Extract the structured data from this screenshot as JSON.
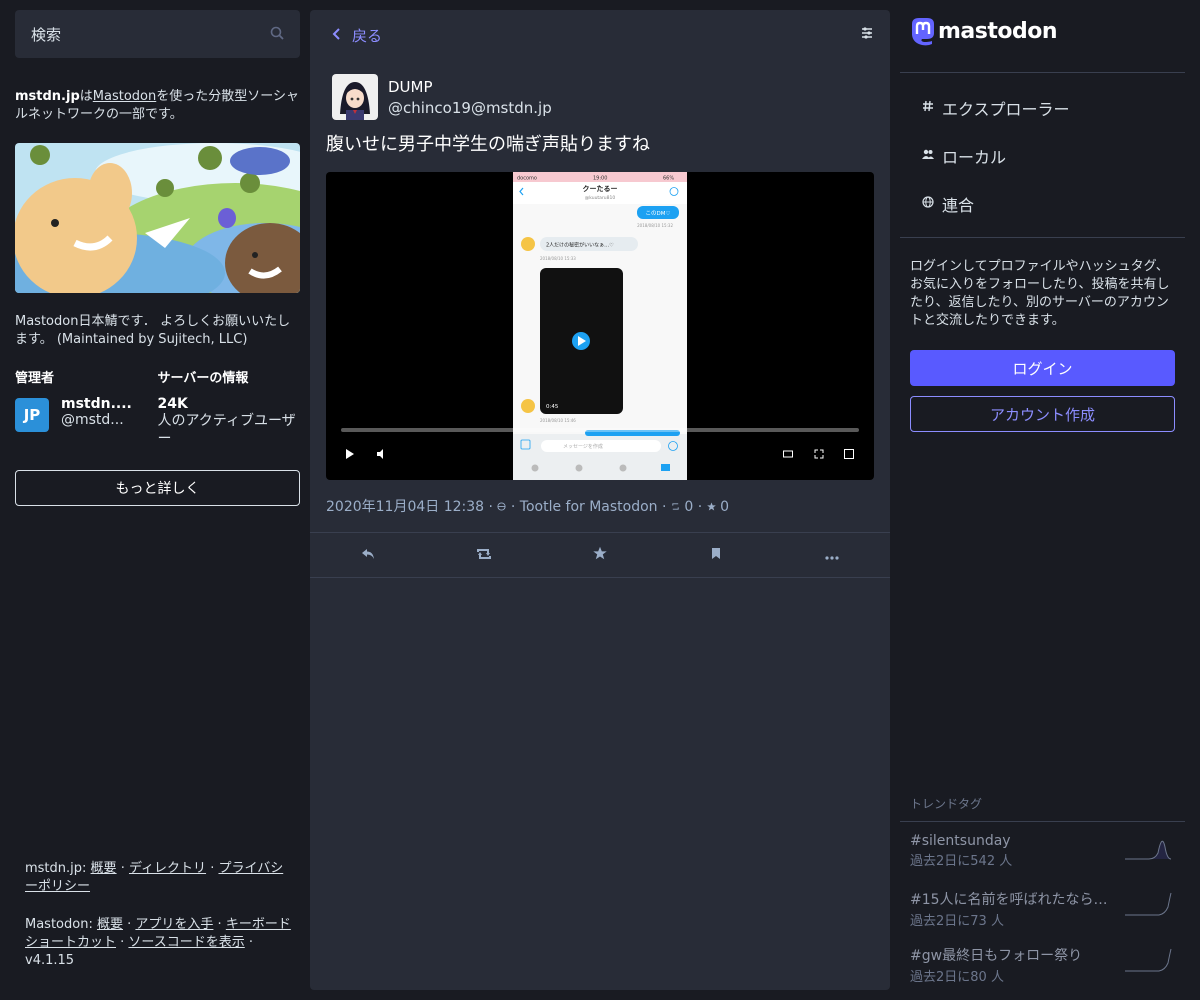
{
  "search": {
    "placeholder": "検索",
    "icon": "search-icon"
  },
  "server": {
    "name": "mstdn.jp",
    "desc_mid": "は",
    "mastodon_link": "Mastodon",
    "desc_tail": "を使った分散型ソーシャルネットワークの一部です。",
    "subtitle": "Mastodon日本鯖です． よろしくお願いいたします。 (Maintained by Sujitech, LLC)",
    "admin_heading": "管理者",
    "info_heading": "サーバーの情報",
    "admin_avatar_text": "JP",
    "admin_name": "mstdn....",
    "admin_handle": "@mstd...",
    "active_users": "24K",
    "active_users_label": "人のアクティブユーザー",
    "more_button": "もっと詳しく"
  },
  "footer": {
    "line1_prefix": "mstdn.jp:",
    "line1_links": [
      "概要",
      "ディレクトリ",
      "プライバシーポリシー"
    ],
    "line2_prefix": "Mastodon:",
    "line2_links": [
      "概要",
      "アプリを入手",
      "キーボードショートカット",
      "ソースコードを表示"
    ],
    "version": "v4.1.15"
  },
  "column": {
    "back_label": "戻る",
    "back_icon": "chevron-left-icon",
    "settings_icon": "sliders-icon"
  },
  "status": {
    "display_name": "DUMP",
    "acct": "@chinco19@mstdn.jp",
    "content": "腹いせに男子中学生の喘ぎ声貼りますね",
    "timestamp": "2020年11月04日 12:38",
    "visibility_icon": "globe-icon",
    "application": "Tootle for Mastodon",
    "reblogs": "0",
    "favourites": "0",
    "video": {
      "phone_title": "クーたるー",
      "phone_sub": "@kuutaru810",
      "bubble_right": "このDM♡",
      "bubble_left": "2人だけの秘密がいいなぁ…♡",
      "date1": "2018/08/10 15:32",
      "date2": "2018/08/10 15:33",
      "date3": "2018/08/10 15:46",
      "clip_time": "0:45",
      "input_placeholder": "メッセージを作成",
      "status_carrier": "docomo",
      "status_time": "19:00",
      "status_battery": "66%"
    }
  },
  "nav": {
    "logo_text": "mastodon",
    "items": [
      {
        "label": "エクスプローラー",
        "icon": "hashtag-icon"
      },
      {
        "label": "ローカル",
        "icon": "users-icon"
      },
      {
        "label": "連合",
        "icon": "globe-icon"
      }
    ],
    "login_text": "ログインしてプロファイルやハッシュタグ、お気に入りをフォローしたり、投稿を共有したり、返信したり、別のサーバーのアカウントと交流したりできます。",
    "login_button": "ログイン",
    "signup_button": "アカウント作成"
  },
  "trends": {
    "title": "トレンドタグ",
    "items": [
      {
        "name": "#silentsunday",
        "count": "過去2日に542 人"
      },
      {
        "name": "#15人に名前を呼ばれたなら…",
        "count": "過去2日に73 人"
      },
      {
        "name": "#gw最終日もフォロー祭り",
        "count": "過去2日に80 人"
      }
    ]
  },
  "colors": {
    "accent": "#595aff",
    "link": "#8c8dff",
    "background": "#191b22",
    "panel": "#282c37"
  }
}
